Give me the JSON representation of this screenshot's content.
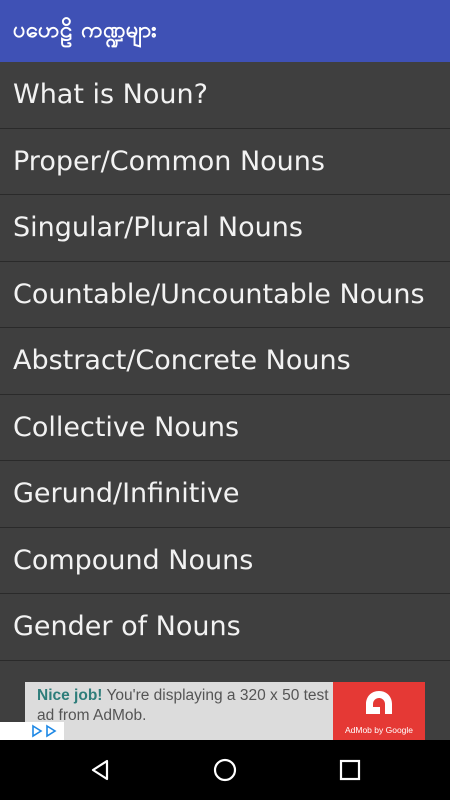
{
  "appbar": {
    "title": "ပဟေဠိ ကဏ္ဍများ"
  },
  "items": [
    {
      "label": "What is Noun?"
    },
    {
      "label": "Proper/Common Nouns"
    },
    {
      "label": "Singular/Plural Nouns"
    },
    {
      "label": "Countable/Uncountable Nouns"
    },
    {
      "label": "Abstract/Concrete Nouns"
    },
    {
      "label": "Collective Nouns"
    },
    {
      "label": "Gerund/Infinitive"
    },
    {
      "label": "Compound Nouns"
    },
    {
      "label": "Gender of Nouns"
    }
  ],
  "ad": {
    "headline": "Nice job!",
    "body": " You're displaying a 320 x 50 test ad from AdMob.",
    "brand": "AdMob by Google",
    "accent": "#e53935"
  },
  "nav": {
    "back": "back-icon",
    "home": "home-icon",
    "recents": "recents-icon"
  },
  "colors": {
    "appbar": "#3f51b5",
    "background": "#3f3f3f",
    "navbar": "#000000"
  }
}
